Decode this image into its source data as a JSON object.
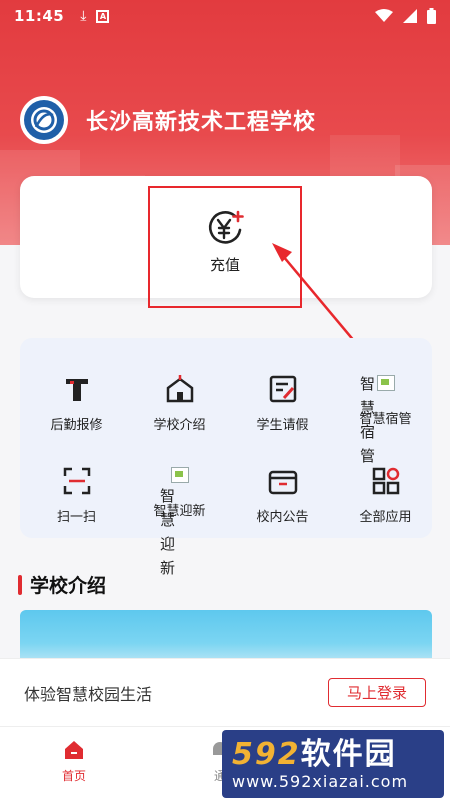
{
  "status_bar": {
    "time": "11:45"
  },
  "header": {
    "school_name": "长沙高新技术工程学校"
  },
  "recharge": {
    "label": "充值"
  },
  "services": [
    {
      "label": "后勤报修",
      "icon": "hammer-icon"
    },
    {
      "label": "学校介绍",
      "icon": "school-building-icon"
    },
    {
      "label": "学生请假",
      "icon": "leave-form-icon"
    },
    {
      "label": "智慧宿管",
      "icon": "broken-image-icon",
      "overflow_text": "智慧宿管"
    },
    {
      "label": "扫一扫",
      "icon": "scan-icon"
    },
    {
      "label": "智慧迎新",
      "icon": "broken-image-icon",
      "overflow_text": "智慧迎新"
    },
    {
      "label": "校内公告",
      "icon": "notice-board-icon"
    },
    {
      "label": "全部应用",
      "icon": "all-apps-icon"
    }
  ],
  "section": {
    "title": "学校介绍"
  },
  "login_bar": {
    "prompt": "体验智慧校园生活",
    "button": "马上登录"
  },
  "tabs": [
    {
      "label": "首页",
      "active": true
    },
    {
      "label": "通",
      "active": false
    }
  ],
  "watermark": {
    "line1_num": "592",
    "line1_txt": "软件园",
    "line2": "www.592xiazai.com"
  },
  "colors": {
    "brand_red": "#e02c31",
    "grid_bg": "#eef2fb"
  }
}
